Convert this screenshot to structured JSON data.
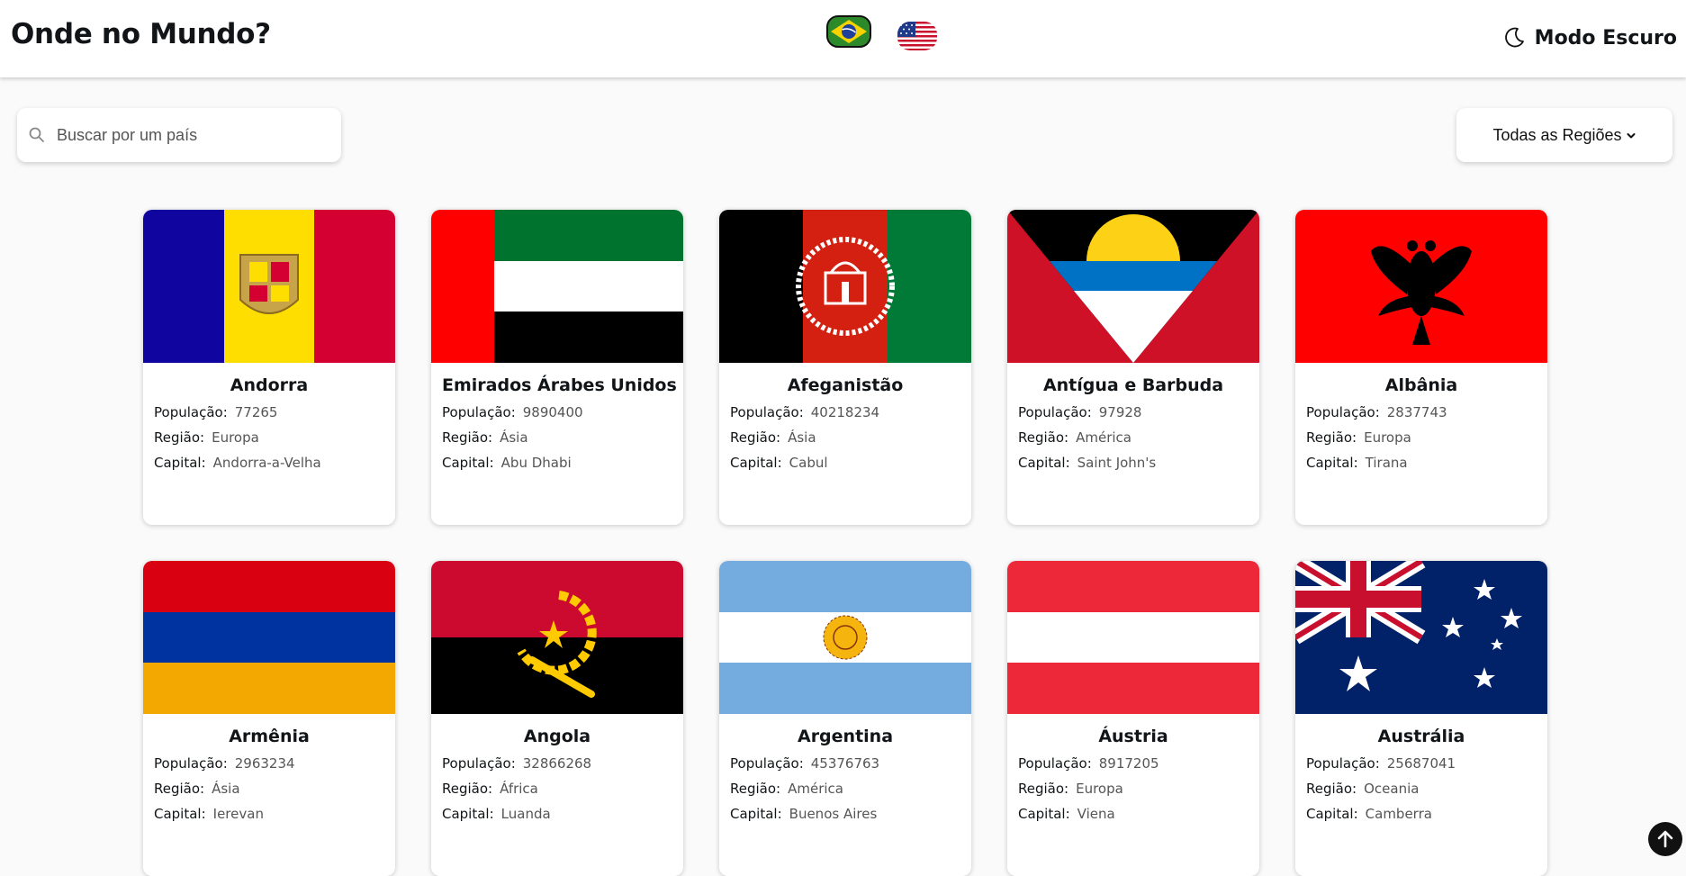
{
  "header": {
    "title": "Onde no Mundo?",
    "theme_toggle": {
      "label": "Modo Escuro",
      "icon": "moon-icon"
    },
    "languages": [
      {
        "code": "pt-BR",
        "icon": "brazil-flag-icon"
      },
      {
        "code": "en-US",
        "icon": "usa-flag-icon"
      }
    ]
  },
  "search": {
    "placeholder": "Buscar por um país",
    "value": ""
  },
  "filter": {
    "selected": "Todas as Regiões",
    "icon": "chevron-down-icon"
  },
  "labels": {
    "population": "População:",
    "region": "Região:",
    "capital": "Capital:"
  },
  "countries": [
    {
      "name": "Andorra",
      "population": "77265",
      "region": "Europa",
      "capital": "Andorra-a-Velha"
    },
    {
      "name": "Emirados Árabes Unidos",
      "population": "9890400",
      "region": "Ásia",
      "capital": "Abu Dhabi"
    },
    {
      "name": "Afeganistão",
      "population": "40218234",
      "region": "Ásia",
      "capital": "Cabul"
    },
    {
      "name": "Antígua e Barbuda",
      "population": "97928",
      "region": "América",
      "capital": "Saint John's"
    },
    {
      "name": "Albânia",
      "population": "2837743",
      "region": "Europa",
      "capital": "Tirana"
    },
    {
      "name": "Armênia",
      "population": "2963234",
      "region": "Ásia",
      "capital": "Ierevan"
    },
    {
      "name": "Angola",
      "population": "32866268",
      "region": "África",
      "capital": "Luanda"
    },
    {
      "name": "Argentina",
      "population": "45376763",
      "region": "América",
      "capital": "Buenos Aires"
    },
    {
      "name": "Áustria",
      "population": "8917205",
      "region": "Europa",
      "capital": "Viena"
    },
    {
      "name": "Austrália",
      "population": "25687041",
      "region": "Oceania",
      "capital": "Camberra"
    }
  ],
  "scroll_top": {
    "icon": "arrow-up-icon"
  }
}
